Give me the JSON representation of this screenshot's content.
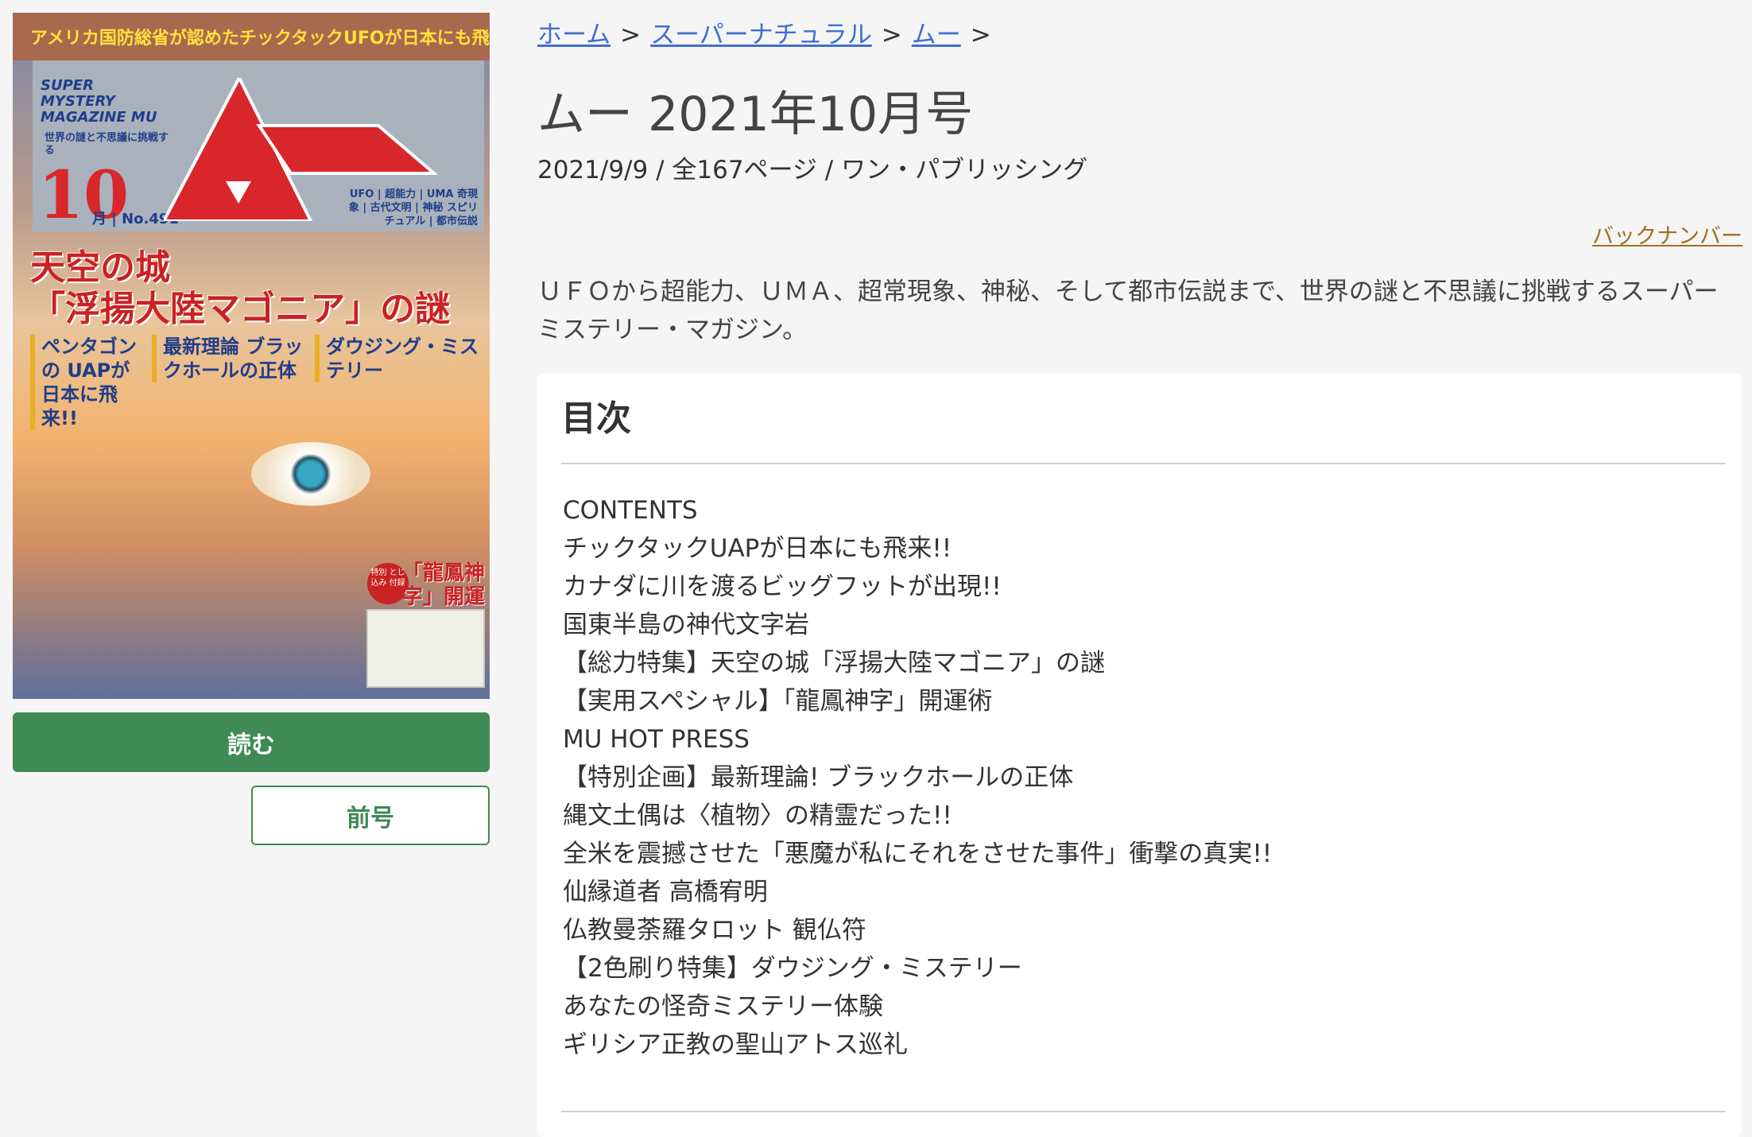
{
  "cover": {
    "top_banner": "アメリカ国防総省が認めたチックタックUFOが日本にも飛来していた!!",
    "masthead_en": "SUPER MYSTERY MAGAZINE MU",
    "masthead_tagline": "世界の謎と不思議に挑戦する",
    "month_number": "10",
    "issue_label": "月 | No.491",
    "logo_text": "ムー",
    "genre_tags": "UFO | 超能力 | UMA 奇現象 | 古代文明 | 神秘 スピリチュアル | 都市伝説",
    "feature_line1": "天空の城",
    "feature_line2": "「浮揚大陸マゴニア」の謎",
    "sub1": "ペンタゴンの UAPが 日本に飛来!!",
    "sub2": "最新理論 ブラックホールの正体",
    "sub3": "ダウジング・ミステリー",
    "badge_label": "特別 とじ込み 付録",
    "badge_title": "「龍鳳神字」開運符"
  },
  "actions": {
    "read_label": "読む",
    "prev_label": "前号"
  },
  "breadcrumb": {
    "home": "ホーム",
    "category": "スーパーナチュラル",
    "magazine": "ムー",
    "separator": ">"
  },
  "title": "ムー 2021年10月号",
  "meta": "2021/9/9 / 全167ページ / ワン・パブリッシング",
  "backnumber_label": "バックナンバー",
  "description": "ＵＦＯから超能力、ＵＭＡ、超常現象、神秘、そして都市伝説まで、世界の謎と不思議に挑戦するスーパーミステリー・マガジン。",
  "toc": {
    "heading": "目次",
    "items": [
      "CONTENTS",
      "チックタックUAPが日本にも飛来!!",
      "カナダに川を渡るビッグフットが出現!!",
      "国東半島の神代文字岩",
      "【総力特集】天空の城「浮揚大陸マゴニア」の謎",
      "【実用スペシャル】「龍鳳神字」開運術",
      "MU HOT PRESS",
      "【特別企画】最新理論! ブラックホールの正体",
      "縄文土偶は〈植物〉の精霊だった!!",
      "全米を震撼させた「悪魔が私にそれをさせた事件」衝撃の真実!!",
      "仙縁道者 高橋宥明",
      "仏教曼荼羅タロット 観仏符",
      "【2色刷り特集】ダウジング・ミステリー",
      "あなたの怪奇ミステリー体験",
      "ギリシア正教の聖山アトス巡礼"
    ]
  }
}
